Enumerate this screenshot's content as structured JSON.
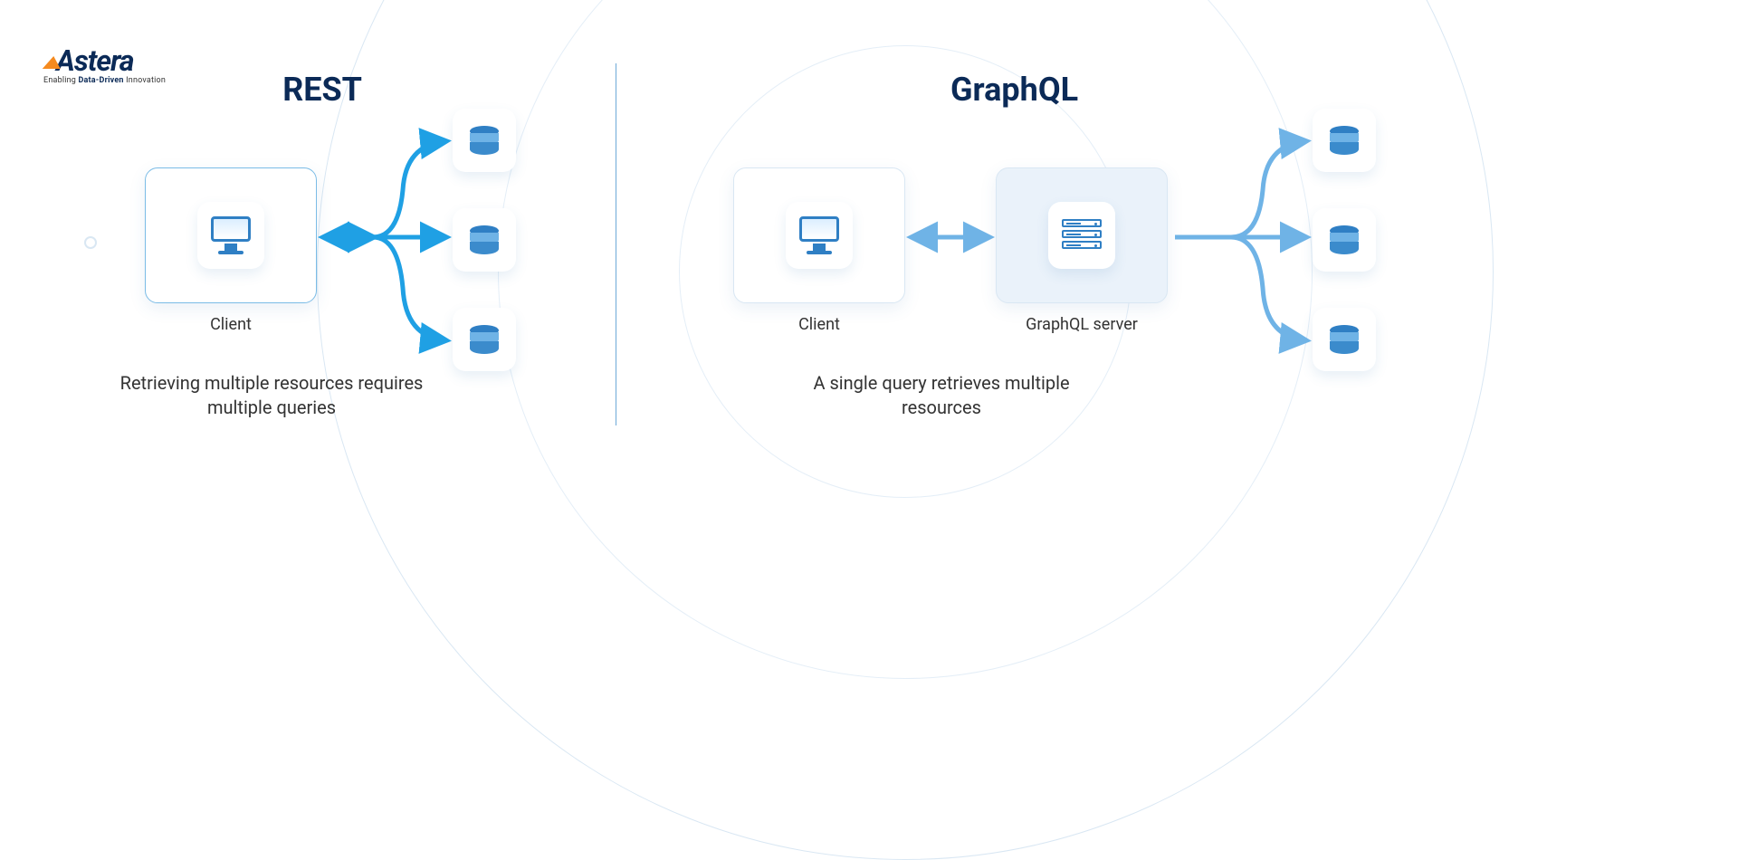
{
  "logo": {
    "brand": "Astera",
    "tagline_prefix": "Enabling ",
    "tagline_bold": "Data-Driven",
    "tagline_suffix": " Innovation"
  },
  "rest": {
    "title": "REST",
    "client_label": "Client",
    "caption": "Retrieving multiple resources requires multiple queries"
  },
  "graphql": {
    "title": "GraphQL",
    "client_label": "Client",
    "server_label": "GraphQL server",
    "caption": "A single query retrieves multiple resources"
  },
  "colors": {
    "accent_dark": "#0b2a57",
    "arrow_bright": "#1fa0e4",
    "arrow_soft": "#6fb3e6",
    "box_border": "#d9e7f3"
  }
}
